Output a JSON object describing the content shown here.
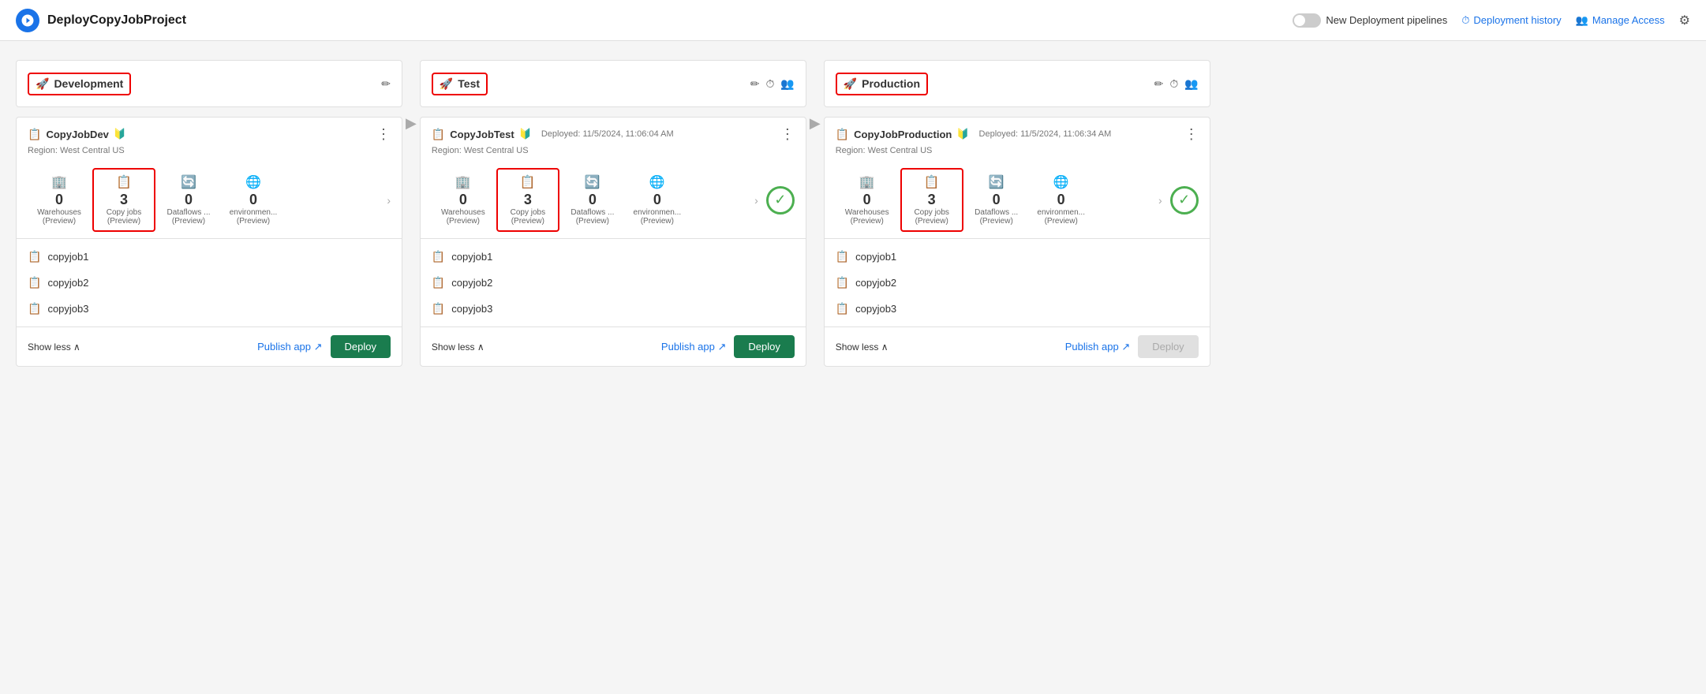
{
  "header": {
    "logo_icon": "rocket-icon",
    "title": "DeployCopyJobProject",
    "toggle_label": "New Deployment pipelines",
    "deployment_history": "Deployment history",
    "manage_access": "Manage Access"
  },
  "pipeline": {
    "stages": [
      {
        "id": "development",
        "name": "Development",
        "has_edit": true,
        "has_history": false,
        "has_users": false,
        "item": {
          "title": "CopyJobDev",
          "has_shield": true,
          "deployed_text": "",
          "region": "Region: West Central US",
          "stats": [
            {
              "icon": "🏢",
              "number": "0",
              "label": "Warehouses\n(Preview)",
              "highlighted": false,
              "red_border": false
            },
            {
              "icon": "📋",
              "number": "3",
              "label": "Copy jobs\n(Preview)",
              "highlighted": false,
              "red_border": true
            },
            {
              "icon": "🔄",
              "number": "0",
              "label": "Dataflows ...\n(Preview)",
              "highlighted": false,
              "red_border": false
            },
            {
              "icon": "🌐",
              "number": "0",
              "label": "environmen...\n(Preview)",
              "highlighted": false,
              "red_border": false
            }
          ],
          "show_check": false,
          "jobs": [
            "copyjob1",
            "copyjob2",
            "copyjob3"
          ],
          "show_less_label": "Show less ∧",
          "publish_label": "Publish app ↗",
          "deploy_label": "Deploy",
          "deploy_disabled": false
        }
      },
      {
        "id": "test",
        "name": "Test",
        "has_edit": true,
        "has_history": true,
        "has_users": true,
        "item": {
          "title": "CopyJobTest",
          "has_shield": true,
          "deployed_text": "Deployed: 11/5/2024, 11:06:04 AM",
          "region": "Region: West Central US",
          "stats": [
            {
              "icon": "🏢",
              "number": "0",
              "label": "Warehouses\n(Preview)",
              "highlighted": false,
              "red_border": false
            },
            {
              "icon": "📋",
              "number": "3",
              "label": "Copy jobs\n(Preview)",
              "highlighted": false,
              "red_border": true
            },
            {
              "icon": "🔄",
              "number": "0",
              "label": "Dataflows ...\n(Preview)",
              "highlighted": false,
              "red_border": false
            },
            {
              "icon": "🌐",
              "number": "0",
              "label": "environmen...\n(Preview)",
              "highlighted": false,
              "red_border": false
            }
          ],
          "show_check": true,
          "jobs": [
            "copyjob1",
            "copyjob2",
            "copyjob3"
          ],
          "show_less_label": "Show less ∧",
          "publish_label": "Publish app ↗",
          "deploy_label": "Deploy",
          "deploy_disabled": false
        }
      },
      {
        "id": "production",
        "name": "Production",
        "has_edit": true,
        "has_history": true,
        "has_users": true,
        "item": {
          "title": "CopyJobProduction",
          "has_shield": true,
          "deployed_text": "Deployed: 11/5/2024, 11:06:34 AM",
          "region": "Region: West Central US",
          "stats": [
            {
              "icon": "🏢",
              "number": "0",
              "label": "Warehouses\n(Preview)",
              "highlighted": false,
              "red_border": false
            },
            {
              "icon": "📋",
              "number": "3",
              "label": "Copy jobs\n(Preview)",
              "highlighted": false,
              "red_border": true
            },
            {
              "icon": "🔄",
              "number": "0",
              "label": "Dataflows ...\n(Preview)",
              "highlighted": false,
              "red_border": false
            },
            {
              "icon": "🌐",
              "number": "0",
              "label": "environmen...\n(Preview)",
              "highlighted": false,
              "red_border": false
            }
          ],
          "show_check": true,
          "jobs": [
            "copyjob1",
            "copyjob2",
            "copyjob3"
          ],
          "show_less_label": "Show less ∧",
          "publish_label": "Publish app ↗",
          "deploy_label": "Deploy",
          "deploy_disabled": true
        }
      }
    ]
  }
}
